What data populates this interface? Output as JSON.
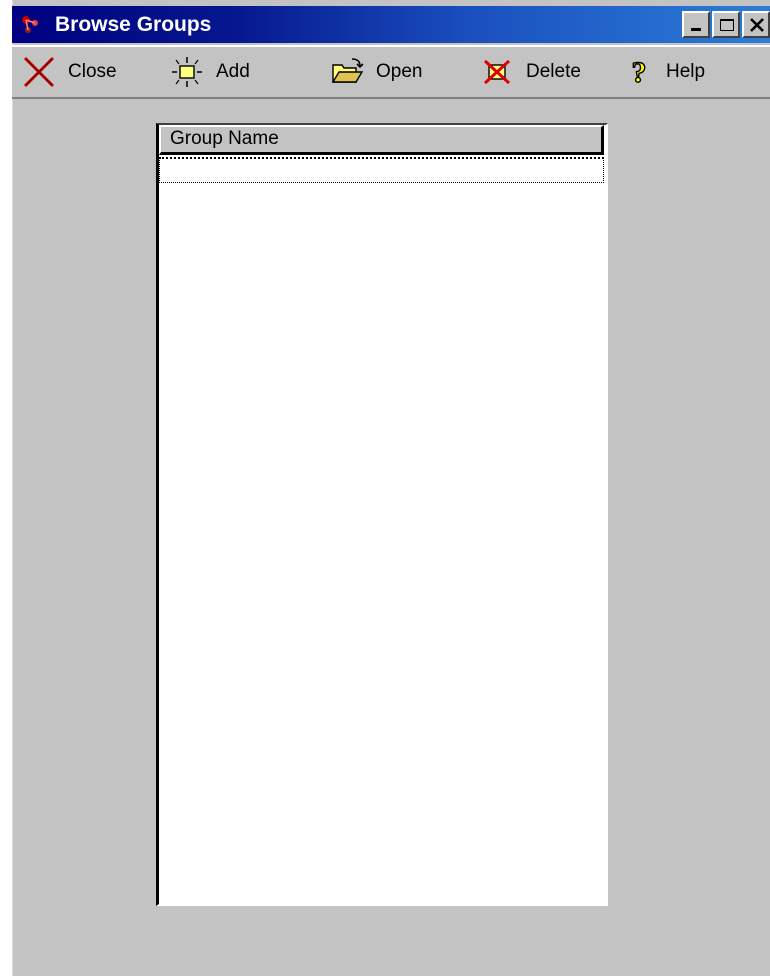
{
  "window": {
    "title": "Browse Groups",
    "controls": {
      "minimize": "minimize-icon",
      "maximize": "maximize-icon",
      "close": "close-icon"
    }
  },
  "toolbar": {
    "close_label": "Close",
    "add_label": "Add",
    "open_label": "Open",
    "delete_label": "Delete",
    "help_label": "Help",
    "icons": {
      "close": "red-x-icon",
      "add": "new-item-sparkle-icon",
      "open": "open-folder-icon",
      "delete": "delete-x-icon",
      "help": "question-mark-icon"
    }
  },
  "list": {
    "columns": [
      "Group Name"
    ],
    "rows": []
  },
  "colors": {
    "titlebar_start": "#000080",
    "titlebar_end": "#2c7dd8",
    "face": "#c3c3c3",
    "list_background": "#ffffff"
  }
}
